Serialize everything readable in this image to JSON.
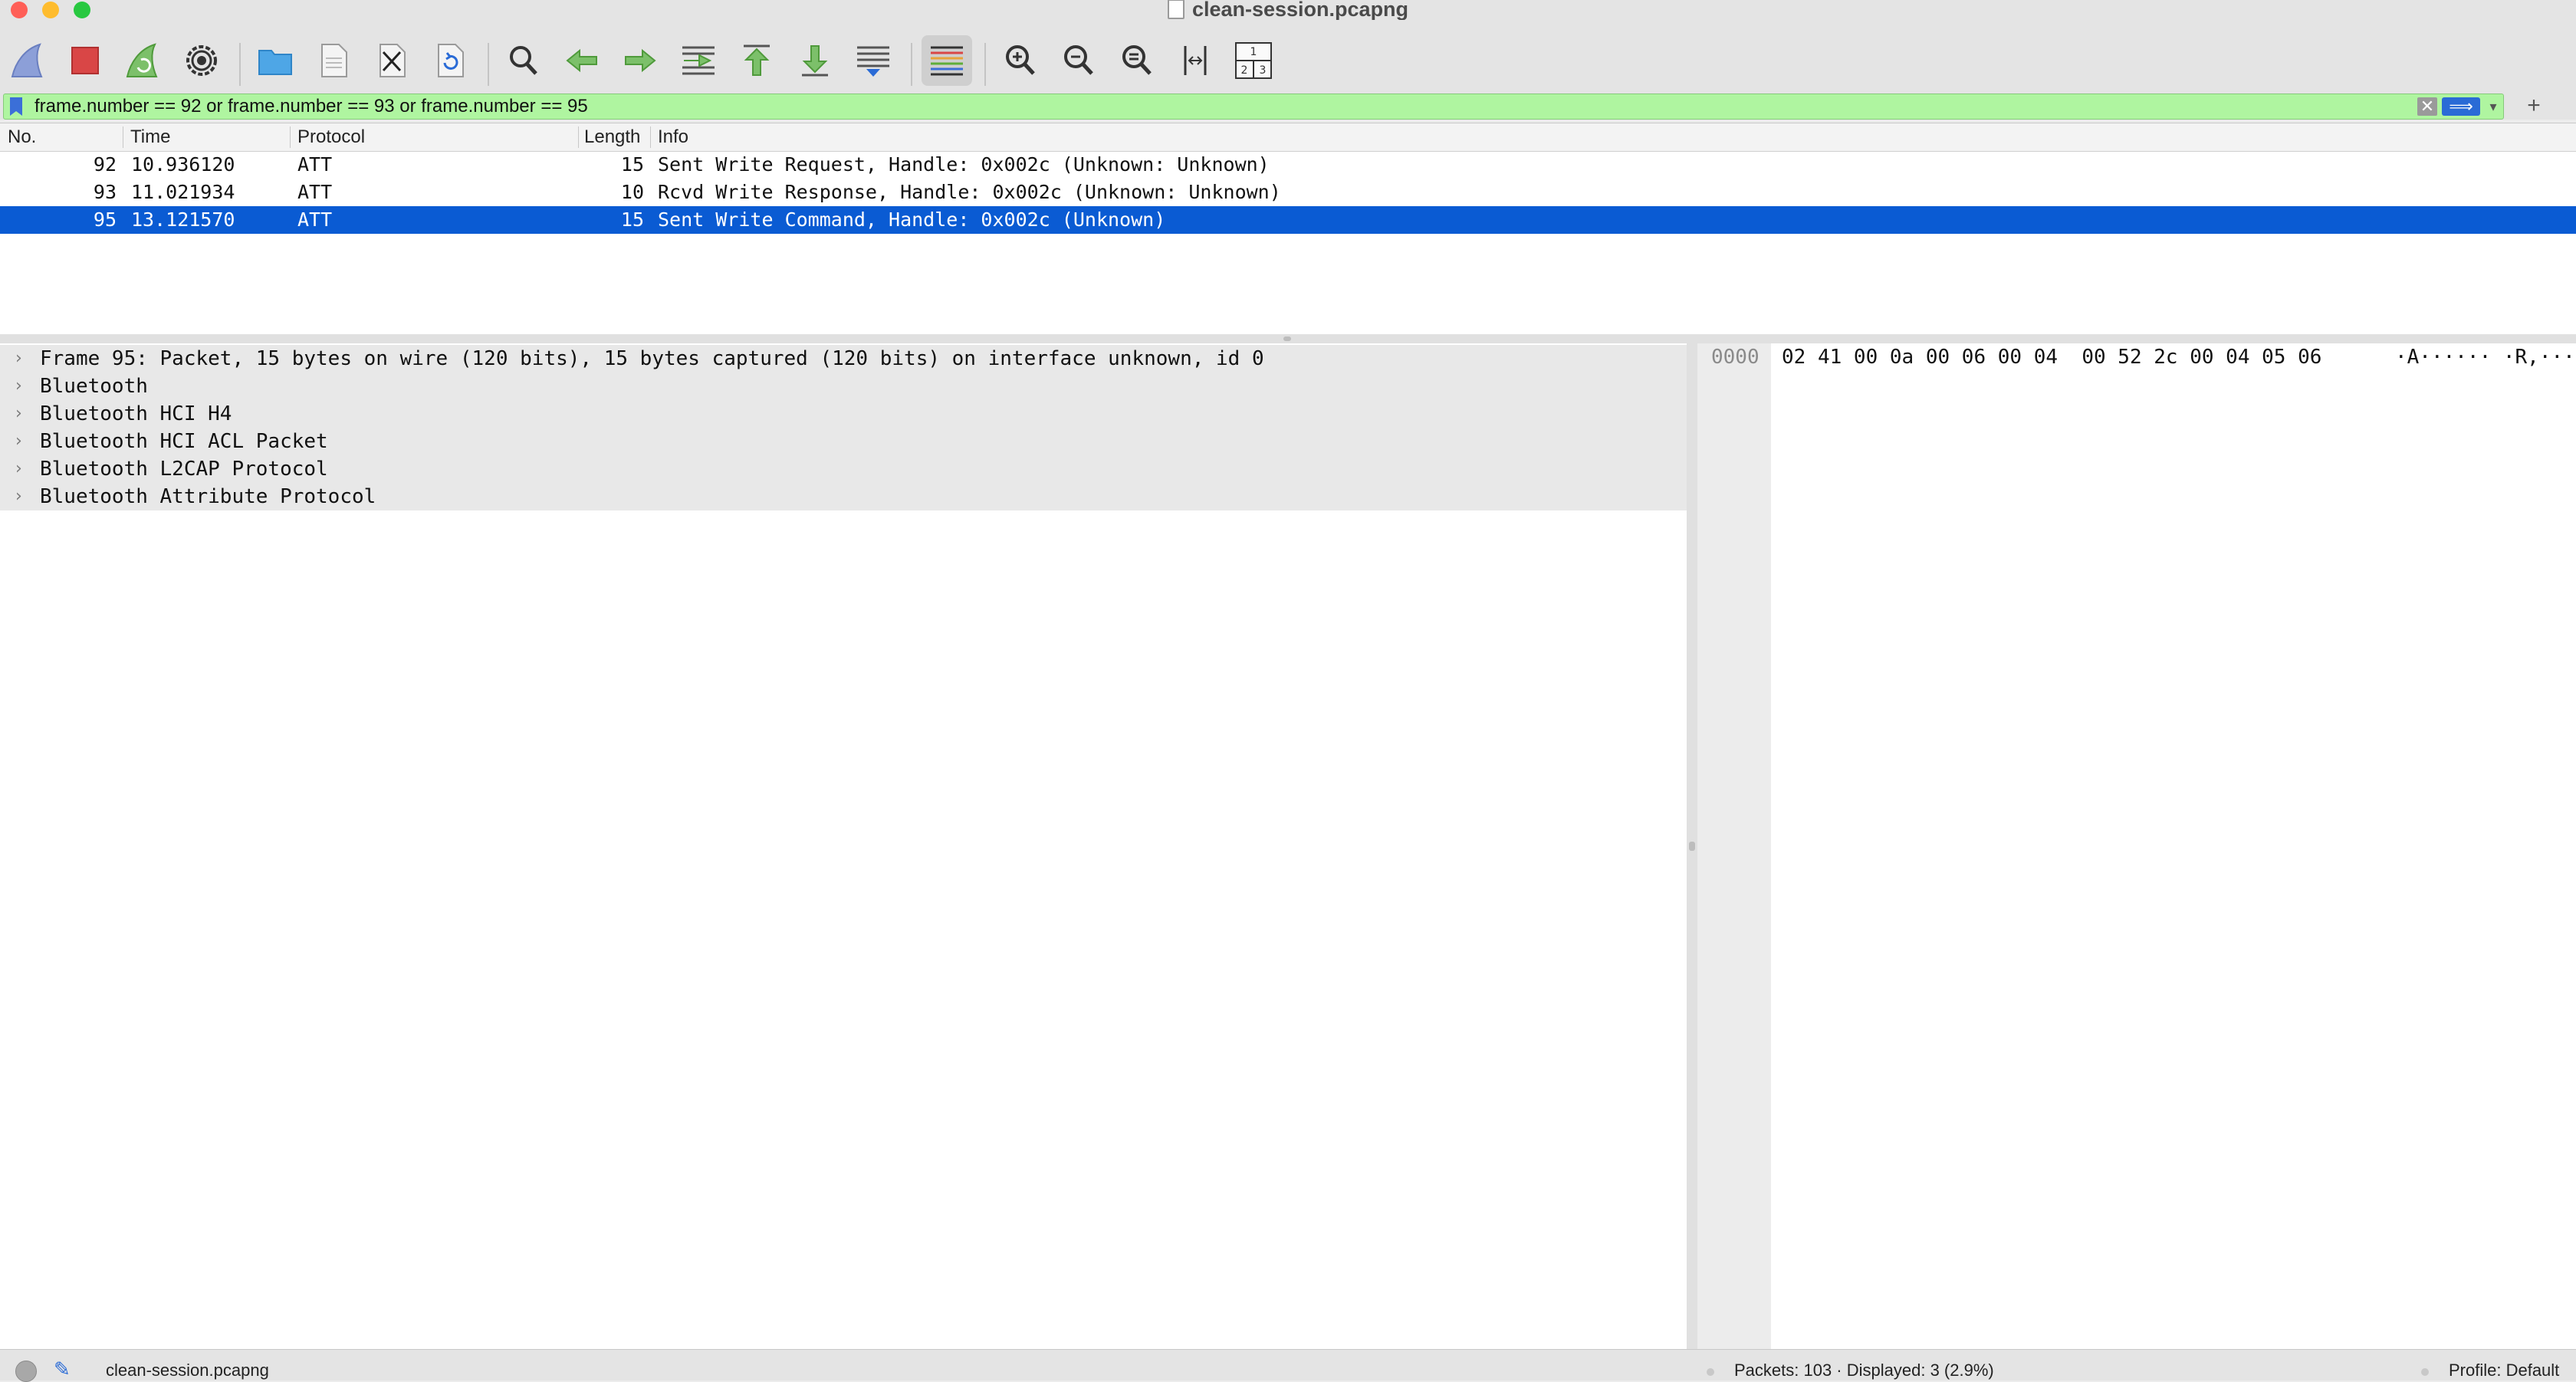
{
  "window": {
    "title": "clean-session.pcapng"
  },
  "toolbar": {
    "buttons": [
      "start-capture",
      "stop-capture",
      "restart-capture",
      "capture-options",
      "open-file",
      "save-file",
      "close-file",
      "reload-file",
      "find-packet",
      "go-back",
      "go-forward",
      "go-to-packet",
      "go-first-packet",
      "go-last-packet",
      "auto-scroll",
      "colorize",
      "zoom-in",
      "zoom-out",
      "normal-size",
      "resize-columns",
      "layout"
    ],
    "colors": {
      "green": "#5fae3a",
      "blue": "#3b6fd8",
      "red": "#d94646"
    }
  },
  "filter": {
    "value": "frame.number == 92 or frame.number == 93 or frame.number == 95",
    "background": "#aff5a0",
    "clear_label": "✕",
    "apply_label": "⟹",
    "history_label": "▾",
    "add_label": "+"
  },
  "packet_list": {
    "columns": [
      "No.",
      "Time",
      "Protocol",
      "Length",
      "Info"
    ],
    "rows": [
      {
        "no": "92",
        "time": "10.936120",
        "protocol": "ATT",
        "length": "15",
        "info": "Sent Write Request, Handle: 0x002c (Unknown: Unknown)",
        "selected": false
      },
      {
        "no": "93",
        "time": "11.021934",
        "protocol": "ATT",
        "length": "10",
        "info": "Rcvd Write Response, Handle: 0x002c (Unknown: Unknown)",
        "selected": false
      },
      {
        "no": "95",
        "time": "13.121570",
        "protocol": "ATT",
        "length": "15",
        "info": "Sent Write Command, Handle: 0x002c (Unknown)",
        "selected": true
      }
    ],
    "selected_color": "#0a5bd3"
  },
  "details": {
    "items": [
      "Frame 95: Packet, 15 bytes on wire (120 bits), 15 bytes captured (120 bits) on interface unknown, id 0",
      "Bluetooth",
      "Bluetooth HCI H4",
      "Bluetooth HCI ACL Packet",
      "Bluetooth L2CAP Protocol",
      "Bluetooth Attribute Protocol"
    ],
    "arrow": "›"
  },
  "bytes": {
    "offset": "0000",
    "hex": "02 41 00 0a 00 06 00 04  00 52 2c 00 04 05 06",
    "ascii": "·A······ ·R,···"
  },
  "status": {
    "file": "clean-session.pcapng",
    "packets": "Packets: 103 · Displayed: 3 (2.9%)",
    "profile": "Profile: Default"
  }
}
